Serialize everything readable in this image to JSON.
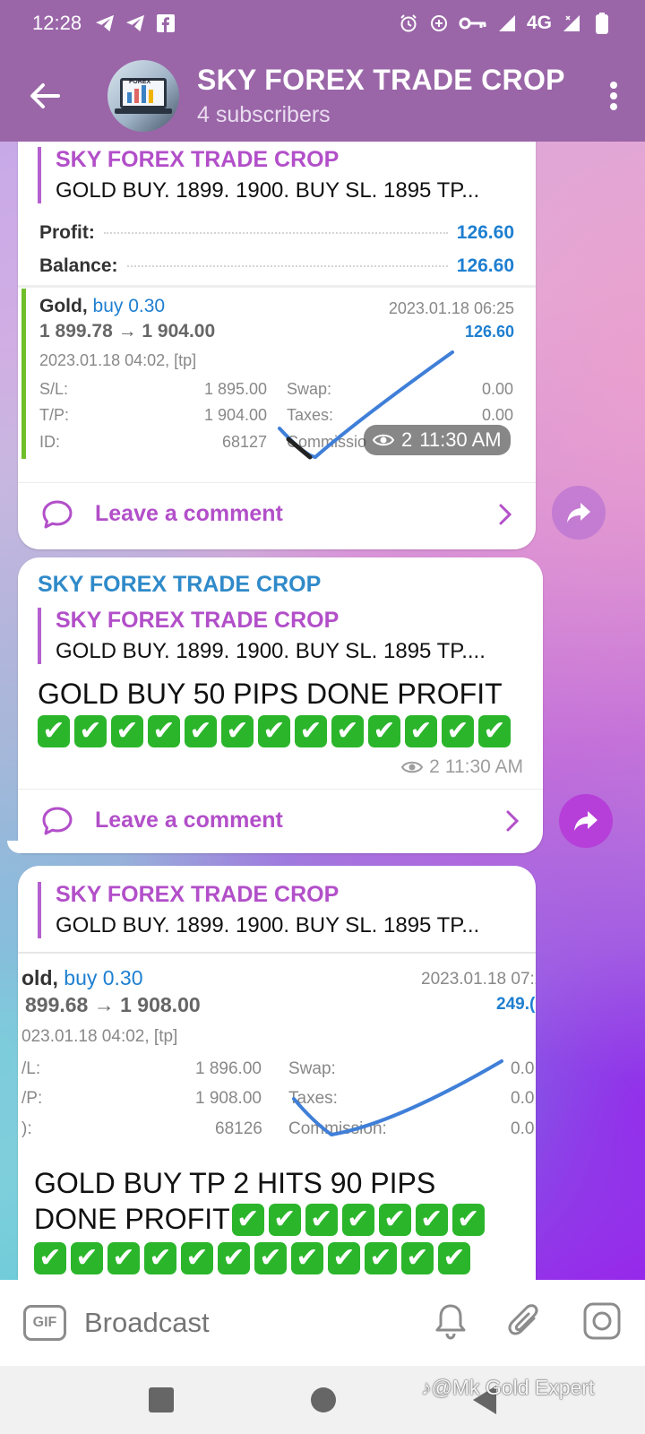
{
  "status_bar": {
    "time": "12:28",
    "network": "4G",
    "left_icons": [
      "telegram-icon",
      "telegram-icon",
      "facebook-icon"
    ],
    "right_icons": [
      "alarm-icon",
      "data-saver-icon",
      "vpn-key-icon",
      "signal-icon",
      "battery-icon"
    ]
  },
  "header": {
    "title": "SKY FOREX TRADE CROP",
    "subtitle": "4 subscribers",
    "avatar_text": "FOREX"
  },
  "messages": [
    {
      "reply": {
        "name": "SKY FOREX TRADE CROP",
        "text": "GOLD BUY. 1899. 1900. BUY  SL.   1895  TP..."
      },
      "trade": {
        "profit_label": "Profit:",
        "profit_value": "126.60",
        "balance_label": "Balance:",
        "balance_value": "126.60",
        "symbol": "Gold,",
        "side": "buy 0.30",
        "close_time": "2023.01.18 06:25",
        "prices": "1 899.78 → 1 904.00",
        "pnl": "126.60",
        "open_time": "2023.01.18 04:02, [tp]",
        "sl_label": "S/L:",
        "sl_value": "1 895.00",
        "swap_label": "Swap:",
        "swap_value": "0.00",
        "tp_label": "T/P:",
        "tp_value": "1 904.00",
        "taxes_label": "Taxes:",
        "taxes_value": "0.00",
        "id_label": "ID:",
        "id_value": "68127",
        "commission_label": "Commissio"
      },
      "views": "2",
      "time": "11:30 AM",
      "comment_label": "Leave a comment"
    },
    {
      "channel": "SKY FOREX TRADE CROP",
      "reply": {
        "name": "SKY FOREX TRADE CROP",
        "text": "GOLD BUY. 1899. 1900. BUY  SL.   1895  TP...."
      },
      "text": "GOLD BUY 50 PIPS DONE PROFIT",
      "check_count": 13,
      "views": "2",
      "time": "11:30 AM",
      "comment_label": "Leave a comment"
    },
    {
      "reply": {
        "name": "SKY FOREX TRADE CROP",
        "text": "GOLD BUY. 1899. 1900. BUY  SL.   1895  TP..."
      },
      "trade": {
        "symbol": "old,",
        "side": "buy 0.30",
        "close_time": "2023.01.18 07:2",
        "prices": "899.68 → 1 908.00",
        "pnl": "249.(",
        "open_time": "023.01.18 04:02, [tp]",
        "sl_label": "/L:",
        "sl_value": "1 896.00",
        "swap_label": "Swap:",
        "swap_value": "0.0",
        "tp_label": "/P:",
        "tp_value": "1 908.00",
        "taxes_label": "Taxes:",
        "taxes_value": "0.0",
        "id_label": "):",
        "id_value": "68126",
        "commission_label": "Commission:",
        "commission_value": "0.0"
      },
      "text_line1": "GOLD BUY TP 2 HITS 90 PIPS",
      "text_line2": "DONE PROFIT",
      "check_count_line2": 7
    }
  ],
  "composer": {
    "gif_label": "GIF",
    "placeholder": "Broadcast"
  },
  "watermark": "@Mk Gold Expert",
  "colors": {
    "header_bg": "#9a66a8",
    "accent_purple": "#b24fc9",
    "channel_blue": "#2f8ac9",
    "check_green": "#2bb52b",
    "trade_blue": "#1e7fd1"
  }
}
